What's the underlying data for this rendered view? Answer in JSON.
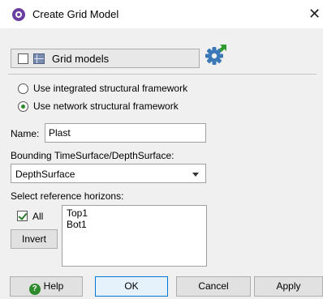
{
  "window": {
    "title": "Create Grid Model",
    "close_glyph": "✕"
  },
  "grid_picker": {
    "label": "Grid models",
    "checked": false
  },
  "framework": {
    "options": [
      {
        "label": "Use integrated structural framework",
        "selected": false
      },
      {
        "label": "Use network structural framework",
        "selected": true
      }
    ]
  },
  "name": {
    "label": "Name:",
    "value": "Plast"
  },
  "bounding": {
    "label": "Bounding TimeSurface/DepthSurface:",
    "selected": "DepthSurface"
  },
  "reference": {
    "label": "Select reference horizons:",
    "all_label": "All",
    "all_checked": true,
    "invert_label": "Invert",
    "horizons": [
      "Top1",
      "Bot1"
    ]
  },
  "buttons": {
    "help": "Help",
    "help_glyph": "?",
    "ok": "OK",
    "cancel": "Cancel",
    "apply": "Apply"
  },
  "colors": {
    "accent": "#0078d7",
    "app_icon": "#6b3fa0",
    "check_green": "#2a8a2a"
  },
  "icons": {
    "app": "app-logo-icon",
    "grid": "grid-icon",
    "settings": "settings-gear-icon",
    "help": "help-icon",
    "close": "close-icon"
  }
}
